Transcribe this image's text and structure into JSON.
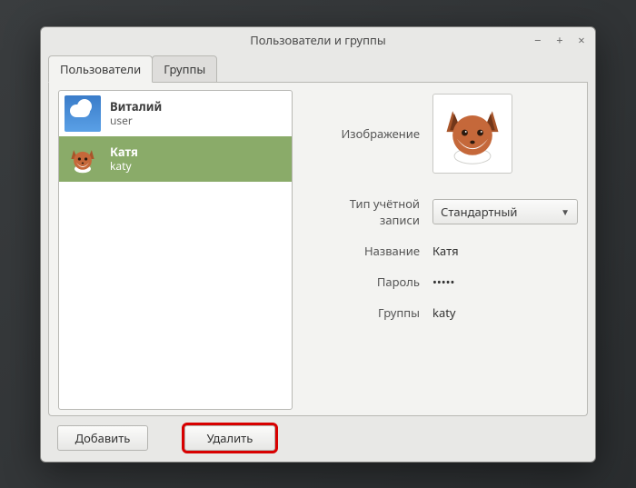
{
  "window": {
    "title": "Пользователи и группы"
  },
  "tabs": {
    "users": "Пользователи",
    "groups": "Группы"
  },
  "users": [
    {
      "display": "Виталий",
      "username": "user",
      "avatar": "clouds",
      "selected": false
    },
    {
      "display": "Катя",
      "username": "katy",
      "avatar": "fox",
      "selected": true
    }
  ],
  "details": {
    "image_label": "Изображение",
    "account_type_label": "Тип учётной записи",
    "account_type_value": "Стандартный",
    "name_label": "Название",
    "name_value": "Катя",
    "password_label": "Пароль",
    "password_value": "•••••",
    "groups_label": "Группы",
    "groups_value": "katy"
  },
  "buttons": {
    "add": "Добавить",
    "delete": "Удалить"
  }
}
